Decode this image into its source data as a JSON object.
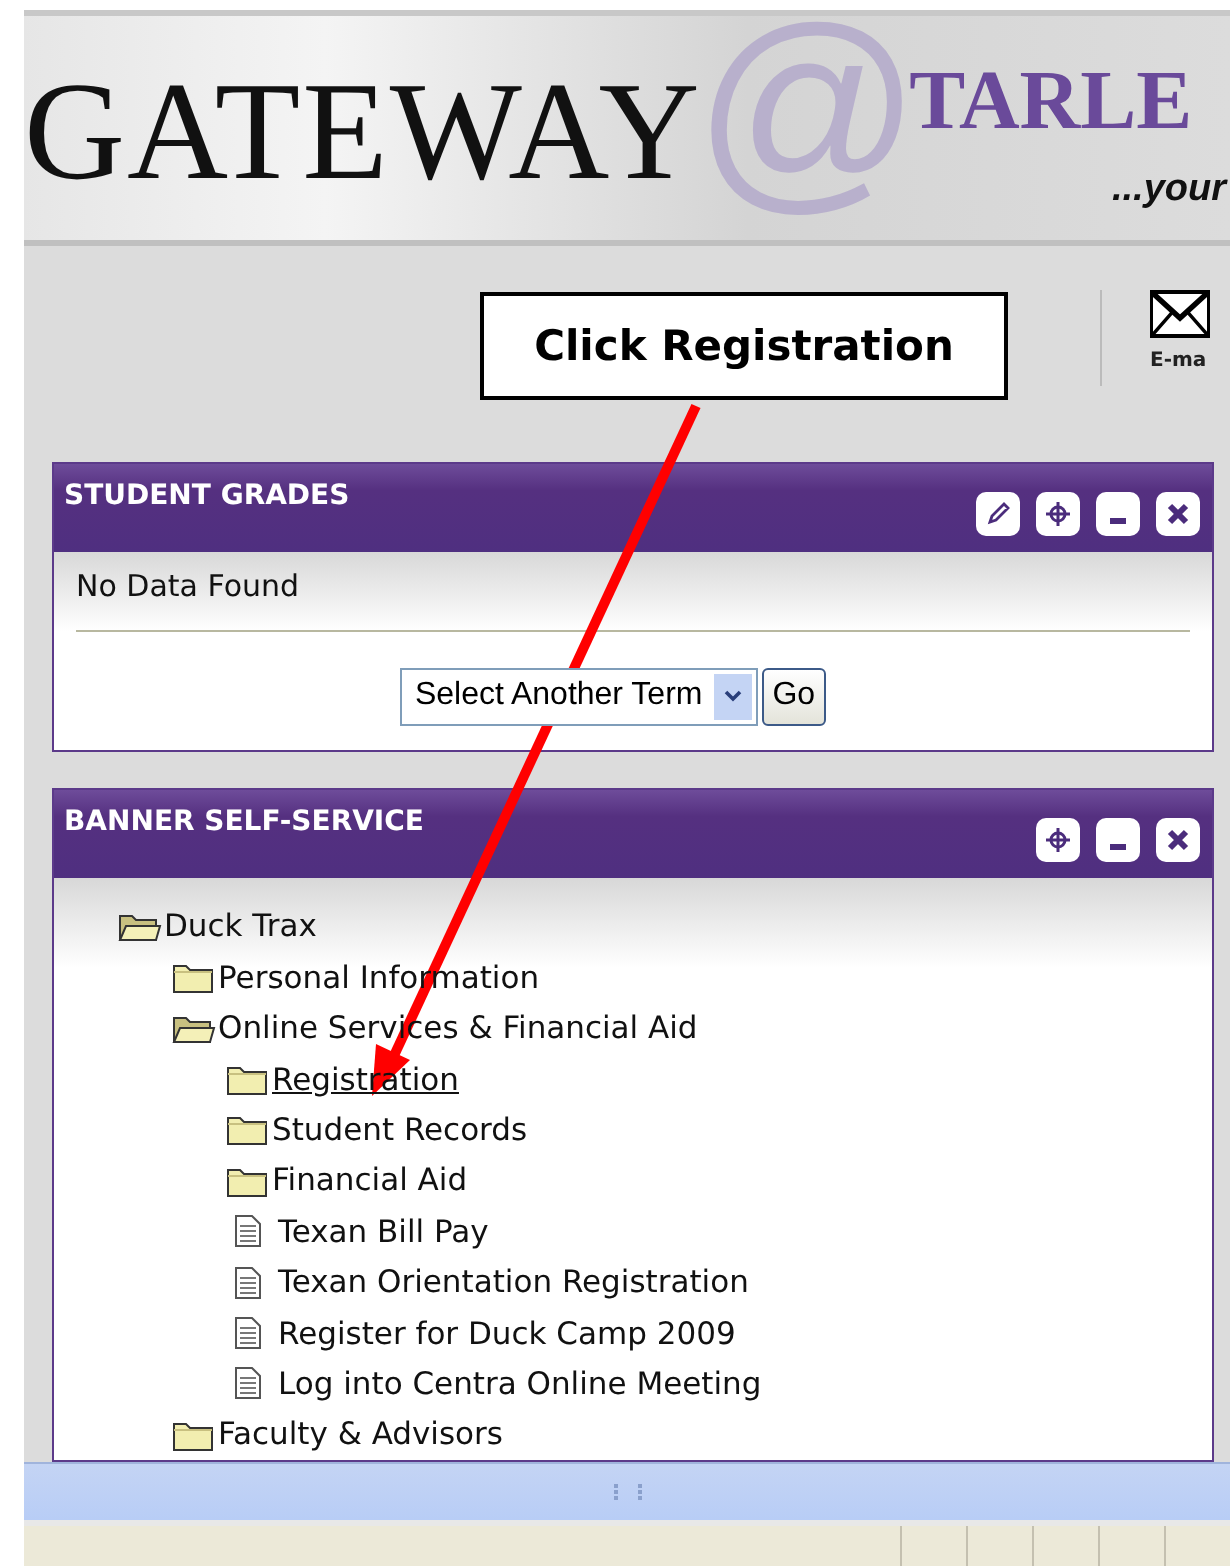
{
  "header": {
    "logo_left": "GATEWAY",
    "logo_at": "@",
    "logo_right": "TARLE",
    "tagline": "...your",
    "email_label": "E-ma"
  },
  "callout": {
    "text": "Click Registration"
  },
  "grades_panel": {
    "title": "STUDENT GRADES",
    "controls": [
      {
        "kind": "edit"
      },
      {
        "kind": "locate"
      },
      {
        "kind": "minimize"
      },
      {
        "kind": "close"
      }
    ],
    "message": "No Data Found",
    "term_select": {
      "value": "Select Another Term"
    },
    "go_button": "Go"
  },
  "banner_panel": {
    "title": "BANNER SELF-SERVICE",
    "controls": [
      {
        "kind": "locate"
      },
      {
        "kind": "minimize"
      },
      {
        "kind": "close"
      }
    ],
    "tree": [
      {
        "label": "Duck Trax",
        "kind": "folder",
        "expanded": true,
        "hovered": false,
        "children": [
          {
            "label": "Personal Information",
            "kind": "folder",
            "expanded": false,
            "hovered": false
          },
          {
            "label": "Online Services & Financial Aid",
            "kind": "folder",
            "expanded": true,
            "hovered": false,
            "children": [
              {
                "label": "Registration",
                "kind": "folder",
                "expanded": false,
                "hovered": true
              },
              {
                "label": "Student Records",
                "kind": "folder",
                "expanded": false,
                "hovered": false
              },
              {
                "label": "Financial Aid",
                "kind": "folder",
                "expanded": false,
                "hovered": false
              },
              {
                "label": "Texan Bill Pay",
                "kind": "page",
                "hovered": false
              },
              {
                "label": "Texan Orientation Registration",
                "kind": "page",
                "hovered": false
              },
              {
                "label": "Register for Duck Camp 2009",
                "kind": "page",
                "hovered": false
              },
              {
                "label": "Log into Centra Online Meeting",
                "kind": "page",
                "hovered": false
              }
            ]
          },
          {
            "label": "Faculty & Advisors",
            "kind": "folder",
            "expanded": false,
            "hovered": false
          }
        ]
      }
    ]
  }
}
